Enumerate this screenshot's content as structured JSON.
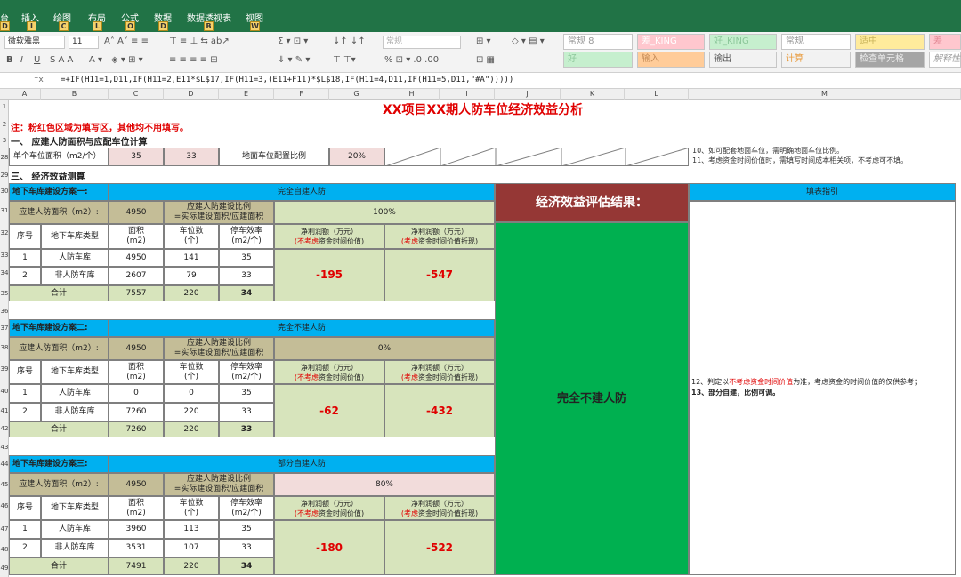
{
  "app": {
    "title_partial": "人防效益测算评估模型图.xlsx"
  },
  "ribbon_tabs": {
    "file": "台",
    "insert": "插入",
    "draw": "绘图",
    "layout": "布局",
    "formulas": "公式",
    "data": "数据",
    "pivot": "数据透视表",
    "view": "视图"
  },
  "keytips": {
    "file": "D",
    "insert": "I",
    "draw": "C",
    "layout": "L",
    "formulas": "O",
    "data": "D",
    "pivot": "B",
    "view": "W"
  },
  "ribbon": {
    "font_name": "微软雅黑",
    "font_size": "11",
    "number_format": "常规",
    "styles": [
      "常规 8",
      "差_KING",
      "好_KING",
      "常规",
      "适中",
      "差",
      "好",
      "输入",
      "输出",
      "计算",
      "检查单元格",
      "解释性"
    ]
  },
  "formula_bar": {
    "fx": "fx",
    "formula": "=+IF(H11=1,D11,IF(H11=2,E11*$L$17,IF(H11=3,(E11+F11)*$L$18,IF(H11=4,D11,IF(H11=5,D11,\"#A\")))))"
  },
  "columns": [
    "A",
    "B",
    "C",
    "D",
    "E",
    "F",
    "G",
    "H",
    "I",
    "J",
    "K",
    "L",
    "M"
  ],
  "rows": [
    "1",
    "2",
    "3",
    "28",
    "29",
    "30",
    "31",
    "32",
    "33",
    "34",
    "35",
    "36",
    "37",
    "38",
    "39",
    "40",
    "41",
    "42",
    "43",
    "44",
    "45",
    "46",
    "47",
    "48",
    "49"
  ],
  "sheet": {
    "title": "XX项目XX期人防车位经济效益分析",
    "note": "注：粉红色区域为填写区，其他均不用填写。",
    "sec1": "一、 应建人防面积与应配车位计算",
    "unit_area_label": "单个车位面积（m2/个）",
    "unit_area_1": "35",
    "unit_area_2": "33",
    "ground_ratio_label": "地面车位配置比例",
    "ground_ratio": "20%",
    "note10": "10、如可配套地面车位，需明确地面车位比例。",
    "note11": "11、考虑资金时间价值时，需填写时间成本相关项，不考虑可不填。",
    "sec3": "三、 经济效益测算",
    "result_header": "经济效益评估结果：",
    "result_text": "完全不建人防",
    "guide_header": "填表指引",
    "note12a": "12、判定以",
    "note12b": "不考虑资金时间价值",
    "note12c": "为准，考虑资金的时间价值的仅供参考；",
    "note13": "13、部分自建，比例可调。",
    "hdr": {
      "idx": "序号",
      "type": "地下车库类型",
      "area": "面积\n(m2)",
      "count": "车位数\n(个)",
      "eff": "停车效率\n(m2/个)",
      "np1_a": "净利润额（万元）",
      "np1_b": "(不考虑",
      "np1_c": "资金时间价值)",
      "np2_a": "净利润额（万元）",
      "np2_b": "(考虑",
      "np2_c": "资金时间价值折现)"
    },
    "area_label": "应建人防面积（m2）:",
    "ratio_label": "应建人防建设比例\n=实际建设面积/应建面积",
    "plans": [
      {
        "title": "地下车库建设方案一:",
        "mode": "完全自建人防",
        "area": "4950",
        "ratio": "100%",
        "rows": [
          {
            "i": "1",
            "type": "人防车库",
            "area": "4950",
            "count": "141",
            "eff": "35"
          },
          {
            "i": "2",
            "type": "非人防车库",
            "area": "2607",
            "count": "79",
            "eff": "33"
          }
        ],
        "total": {
          "label": "合计",
          "area": "7557",
          "count": "220",
          "eff": "34"
        },
        "np1": "-195",
        "np2": "-547"
      },
      {
        "title": "地下车库建设方案二:",
        "mode": "完全不建人防",
        "area": "4950",
        "ratio": "0%",
        "rows": [
          {
            "i": "1",
            "type": "人防车库",
            "area": "0",
            "count": "0",
            "eff": "35"
          },
          {
            "i": "2",
            "type": "非人防车库",
            "area": "7260",
            "count": "220",
            "eff": "33"
          }
        ],
        "total": {
          "label": "合计",
          "area": "7260",
          "count": "220",
          "eff": "33"
        },
        "np1": "-62",
        "np2": "-432"
      },
      {
        "title": "地下车库建设方案三:",
        "mode": "部分自建人防",
        "area": "4950",
        "ratio": "80%",
        "rows": [
          {
            "i": "1",
            "type": "人防车库",
            "area": "3960",
            "count": "113",
            "eff": "35"
          },
          {
            "i": "2",
            "type": "非人防车库",
            "area": "3531",
            "count": "107",
            "eff": "33"
          }
        ],
        "total": {
          "label": "合计",
          "area": "7491",
          "count": "220",
          "eff": "34"
        },
        "np1": "-180",
        "np2": "-522"
      }
    ]
  },
  "colors": {
    "excel_green": "#217346",
    "blue": "#00b0f0",
    "tan": "#c4bd97",
    "sage": "#d7e4bc",
    "pink": "#f2dcdb",
    "dark_red": "#953735",
    "green": "#00b050",
    "red": "#e00000"
  }
}
